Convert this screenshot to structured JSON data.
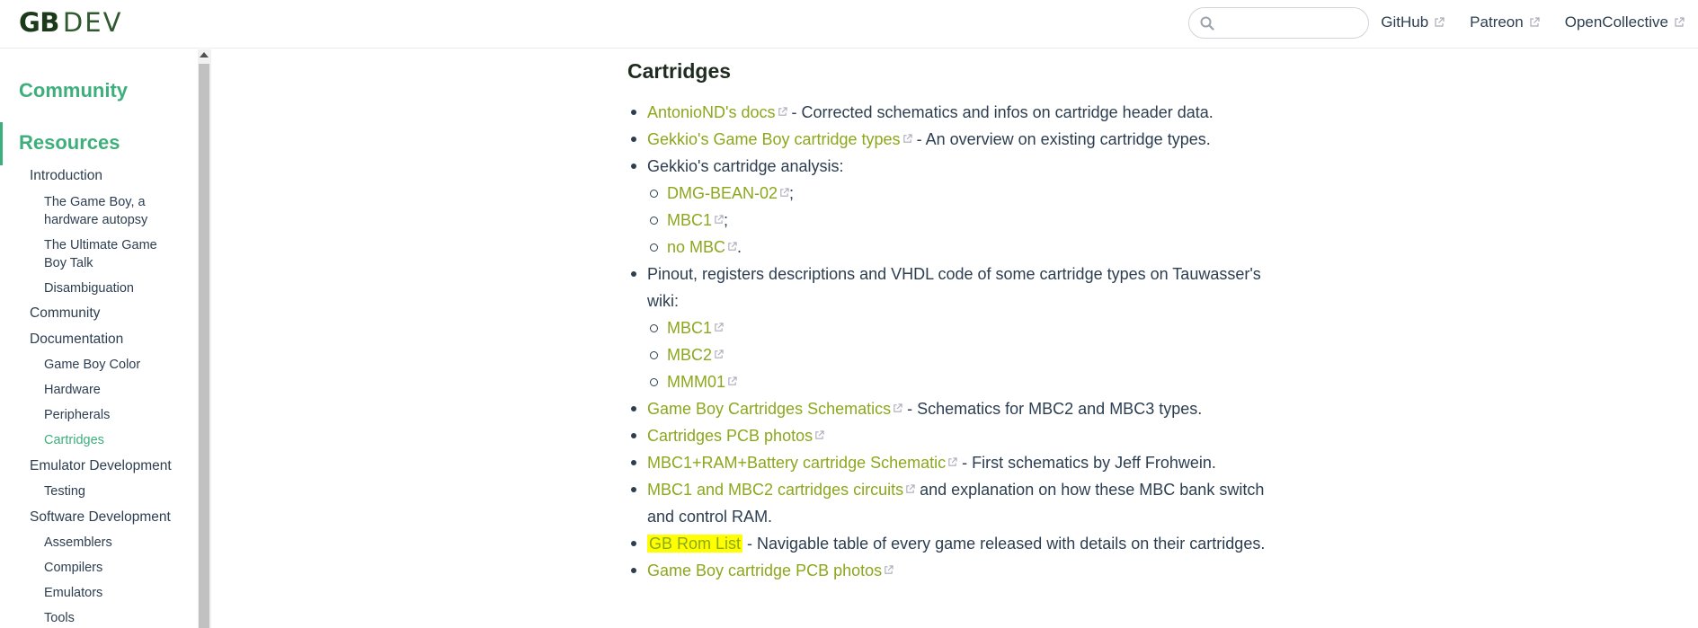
{
  "navbar": {
    "logo_main": "GB",
    "logo_sub": "DEV",
    "search_placeholder": "",
    "links": [
      "GitHub",
      "Patreon",
      "OpenCollective"
    ]
  },
  "sidebar": {
    "groups": [
      "Community",
      "Resources"
    ],
    "items": [
      {
        "label": "Introduction",
        "level": 1
      },
      {
        "label": "The Game Boy, a hardware autopsy",
        "level": 2
      },
      {
        "label": "The Ultimate Game Boy Talk",
        "level": 2
      },
      {
        "label": "Disambiguation",
        "level": 2
      },
      {
        "label": "Community",
        "level": 1
      },
      {
        "label": "Documentation",
        "level": 1
      },
      {
        "label": "Game Boy Color",
        "level": 2
      },
      {
        "label": "Hardware",
        "level": 2
      },
      {
        "label": "Peripherals",
        "level": 2
      },
      {
        "label": "Cartridges",
        "level": 2,
        "active": true
      },
      {
        "label": "Emulator Development",
        "level": 1
      },
      {
        "label": "Testing",
        "level": 2
      },
      {
        "label": "Software Development",
        "level": 1
      },
      {
        "label": "Assemblers",
        "level": 2
      },
      {
        "label": "Compilers",
        "level": 2
      },
      {
        "label": "Emulators",
        "level": 2
      },
      {
        "label": "Tools",
        "level": 2
      }
    ]
  },
  "content": {
    "heading": "Cartridges",
    "list": [
      {
        "link": "AntonioND's docs",
        "text": " - Corrected schematics and infos on cartridge header data."
      },
      {
        "link": "Gekkio's Game Boy cartridge types",
        "text": " - An overview on existing cartridge types."
      },
      {
        "text_only": "Gekkio's cartridge analysis:",
        "sub": [
          {
            "link": "DMG-BEAN-02",
            "suffix": ";"
          },
          {
            "link": "MBC1",
            "suffix": ";"
          },
          {
            "link": "no MBC",
            "suffix": "."
          }
        ]
      },
      {
        "text_only": "Pinout, registers descriptions and VHDL code of some cartridge types on Tauwasser's wiki:",
        "sub": [
          {
            "link": "MBC1",
            "suffix": ""
          },
          {
            "link": "MBC2",
            "suffix": ""
          },
          {
            "link": "MMM01",
            "suffix": ""
          }
        ]
      },
      {
        "link": "Game Boy Cartridges Schematics",
        "text": " - Schematics for MBC2 and MBC3 types."
      },
      {
        "link": "Cartridges PCB photos",
        "text": ""
      },
      {
        "link": "MBC1+RAM+Battery cartridge Schematic",
        "text": " - First schematics by Jeff Frohwein."
      },
      {
        "link": "MBC1 and MBC2 cartridges circuits",
        "text": " and explanation on how these MBC bank switch and control RAM."
      },
      {
        "link": "GB Rom List",
        "text": " - Navigable table of every game released with details on their cartridges.",
        "highlight": true
      },
      {
        "link": "Game Boy cartridge PCB photos",
        "text": ""
      }
    ]
  },
  "colors": {
    "accent": "#3eaf7c",
    "link": "#8ba81c",
    "highlight": "#ffff00",
    "text": "#2c3e50"
  }
}
